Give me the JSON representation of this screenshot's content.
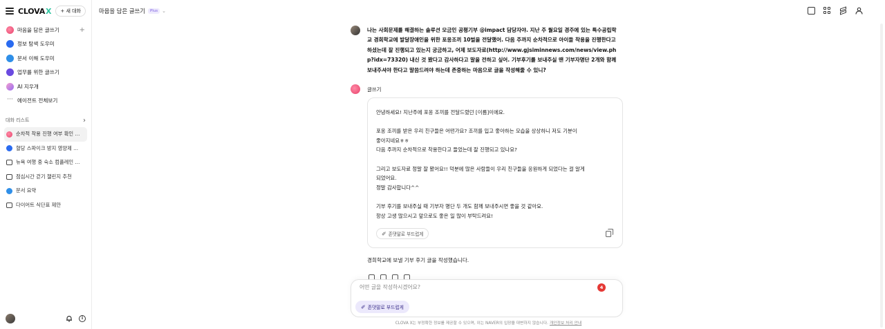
{
  "app": {
    "logo_text": "CLOVA",
    "logo_accent": "X",
    "new_chat_label": "+ 새 대화"
  },
  "sidebar": {
    "nav": [
      {
        "label": "마음을 담은 글쓰기",
        "icon": "pink-pen-icon",
        "color": "#f0507a"
      },
      {
        "label": "정보 탐색 도우미",
        "icon": "compass-icon",
        "color": "#2a6bf0"
      },
      {
        "label": "문서 이해 도우미",
        "icon": "document-icon",
        "color": "#2f8fe8"
      },
      {
        "label": "업무를 위한 글쓰기",
        "icon": "pencil-icon",
        "color": "#6a4ae0"
      },
      {
        "label": "AI 지우개",
        "icon": "eraser-icon",
        "color": "#b56cf0"
      },
      {
        "label": "에이전트 전체보기",
        "icon": "more-icon",
        "color": "#666666"
      }
    ],
    "history_title": "대화 리스트",
    "history": [
      {
        "label": "순차적 착용 진행 여부 확인 ...",
        "type": "pink"
      },
      {
        "label": "혈당 스파이크 방지 영양제 ...",
        "type": "blue"
      },
      {
        "label": "뉴욕 여행 중 숙소 컴플레인 ...",
        "type": "chat"
      },
      {
        "label": "점심시간 걷기 챌린지 추천",
        "type": "chat"
      },
      {
        "label": "문서 요약",
        "type": "doc"
      },
      {
        "label": "다이어트 식단표 제안",
        "type": "chat"
      }
    ]
  },
  "header": {
    "title": "마음을 담은 글쓰기",
    "badge": "Plus"
  },
  "conversation": {
    "user_message": "나는 사회문제를 해결하는 솔루션 모금인 공평기부 @impact 담당자야. 지난 주 월요일 경주에 있는 특수공립학교 경희학교에 발달장애인을 위한 포옹조끼 10벌을 전달했어. 다음 주까지 순차적으로 아이들 착용을 진행한다고 하셨는데 잘 진행되고 있는지 궁금하고, 어제 보도자료(http://www.gjsiminnews.com/news/view.php?idx=73320) 내신 것 봤다고 감사하다고 말을 전하고 싶어. 기부후기를 보내주실 땐 기부자명단 2개와 함께 보내주셔야 한다고 말씀드려야 하는데 존중하는 마음으로 글을 작성해줄 수 있니?",
    "bot_name": "글쓰기",
    "reply_paragraphs": [
      [
        "안녕하세요! 지난주에 포옹 조끼를 전달드렸던 [이름]이에요."
      ],
      [
        "포옹 조끼를 받은 우리 친구들은 어떤가요? 조끼를 입고 좋아하는 모습을 상상하니 저도 기분이",
        "좋아지네요ㅎㅎ",
        "다음 주까지 순차적으로 착용한다고 들었는데 잘 진행되고 있나요?"
      ],
      [
        "그리고 보도자료 정말 잘 봤어요!! 덕분에 많은 사람들이 우리 친구들을 응원하게 되었다는 걸 알게",
        "되었어요.",
        "정말 감사합니다^^"
      ],
      [
        "기부 후기를 보내주실 때 기부자 명단 두 개도 함께 보내주시면 좋을 것 같아요.",
        "항상 고생 많으시고 앞으로도 좋은 일 많이 부탁드려요!"
      ]
    ],
    "soften_button": "존댓말로 부드럽게",
    "summary": "경희학교에 보낼 기부 후기 글을 작성했습니다."
  },
  "composer": {
    "placeholder": "어떤 글을 작성하시겠어요?",
    "badge_count": "4",
    "soften_pill": "존댓말로 부드럽게"
  },
  "footer": {
    "disclaimer": "CLOVA X는 부정확한 정보를 제공할 수 있으며, 이는 NAVER의 입장을 대변하지 않습니다.",
    "privacy_link": "개인정보 처리 안내"
  }
}
